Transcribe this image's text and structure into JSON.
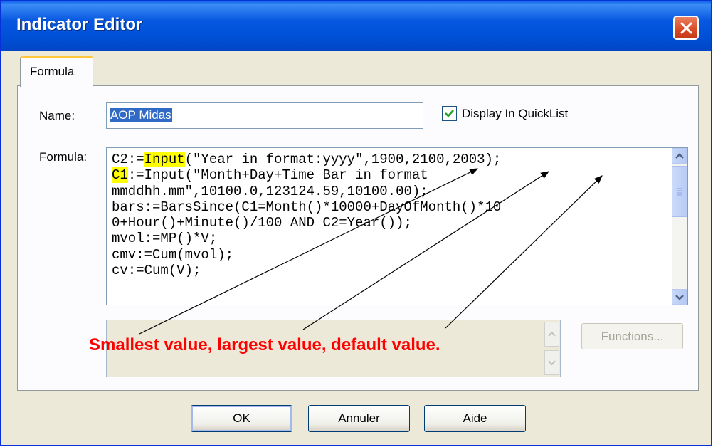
{
  "window": {
    "title": "Indicator Editor"
  },
  "tabs": [
    {
      "label": "Formula",
      "active": true
    }
  ],
  "name_field": {
    "label": "Name:",
    "value": "AOP Midas"
  },
  "display_quicklist": {
    "label": "Display In QuickList",
    "checked": true
  },
  "formula": {
    "label": "Formula:",
    "lines": [
      {
        "segments": [
          {
            "text": "C2:="
          },
          {
            "text": "Input",
            "highlight": true
          },
          {
            "text": "(\"Year in format:yyyy\",1900,2100,2003);"
          }
        ]
      },
      {
        "segments": [
          {
            "text": "C1",
            "highlight": true
          },
          {
            "text": ":=Input(\"Month+Day+Time Bar in format"
          }
        ]
      },
      {
        "segments": [
          {
            "text": "mmddhh.mm\",10100.0,123124.59,10100.00);"
          }
        ]
      },
      {
        "segments": [
          {
            "text": "bars:=BarsSince(C1=Month()*10000+DayOfMonth()*10"
          }
        ]
      },
      {
        "segments": [
          {
            "text": "0+Hour()+Minute()/100 AND C2=Year());"
          }
        ]
      },
      {
        "segments": [
          {
            "text": "mvol:=MP()*V;"
          }
        ]
      },
      {
        "segments": [
          {
            "text": "cmv:=Cum(mvol);"
          }
        ]
      },
      {
        "segments": [
          {
            "text": "cv:=Cum(V);"
          }
        ]
      }
    ]
  },
  "annotation": {
    "text": "Smallest value, largest value, default value.",
    "color": "#ff0000"
  },
  "buttons": {
    "functions": "Functions...",
    "ok": "OK",
    "cancel": "Annuler",
    "help": "Aide"
  },
  "colors": {
    "title_bar": "#0054e3",
    "highlight": "#ffff00",
    "selection": "#316ac5",
    "checkbox_mark": "#21a121"
  },
  "icons": {
    "close": "close-x-icon",
    "checkbox": "checkmark-icon",
    "scroll_up": "chevron-up-icon",
    "scroll_down": "chevron-down-icon"
  }
}
